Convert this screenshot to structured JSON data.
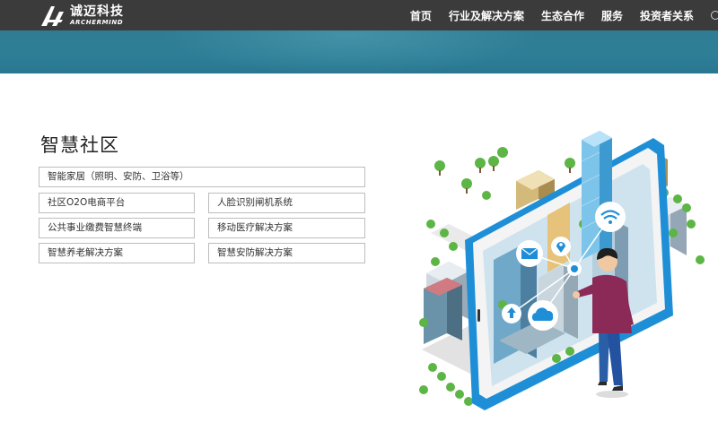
{
  "header": {
    "logo_cn": "诚迈科技",
    "logo_en": "ARCHERMIND",
    "nav": [
      "首页",
      "行业及解决方案",
      "生态合作",
      "服务",
      "投资者关系"
    ]
  },
  "section": {
    "title": "智慧社区",
    "wide_item": "智能家居（照明、安防、卫浴等）",
    "items": [
      "社区O2O电商平台",
      "人脸识别闸机系统",
      "公共事业缴费智慧终端",
      "移动医疗解决方案",
      "智慧养老解决方案",
      "智慧安防解决方案"
    ]
  },
  "colors": {
    "topbar": "#3b3b3b",
    "banner": "#2e7e97",
    "accent_blue": "#1e8fd6",
    "tree_green": "#5cb545"
  },
  "icons": [
    "logo-mark",
    "globe-icon",
    "wifi-icon",
    "mail-icon",
    "location-icon",
    "cloud-icon",
    "upload-icon"
  ]
}
